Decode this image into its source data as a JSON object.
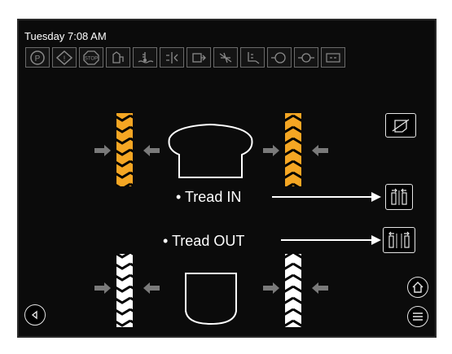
{
  "status_bar": {
    "clock": "Tuesday 7:08 AM"
  },
  "indicators": [
    {
      "name": "parking-brake-icon"
    },
    {
      "name": "warning-icon"
    },
    {
      "name": "stop-icon"
    },
    {
      "name": "fuel-icon"
    },
    {
      "name": "coolant-temp-icon"
    },
    {
      "name": "hydraulic-icon"
    },
    {
      "name": "transmission-icon"
    },
    {
      "name": "filter-restricted-icon"
    },
    {
      "name": "seat-icon"
    },
    {
      "name": "oil-pressure-icon"
    },
    {
      "name": "engine-oil-icon"
    },
    {
      "name": "battery-icon"
    }
  ],
  "callouts": {
    "tread_in": "• Tread IN",
    "tread_out": "• Tread OUT"
  },
  "colors": {
    "screen_bg": "#0b0b0b",
    "active_tire": "#f5a623",
    "inactive_tire": "#ffffff",
    "arrow": "#7a7a7a",
    "indicator_border": "#6a6a6a"
  }
}
